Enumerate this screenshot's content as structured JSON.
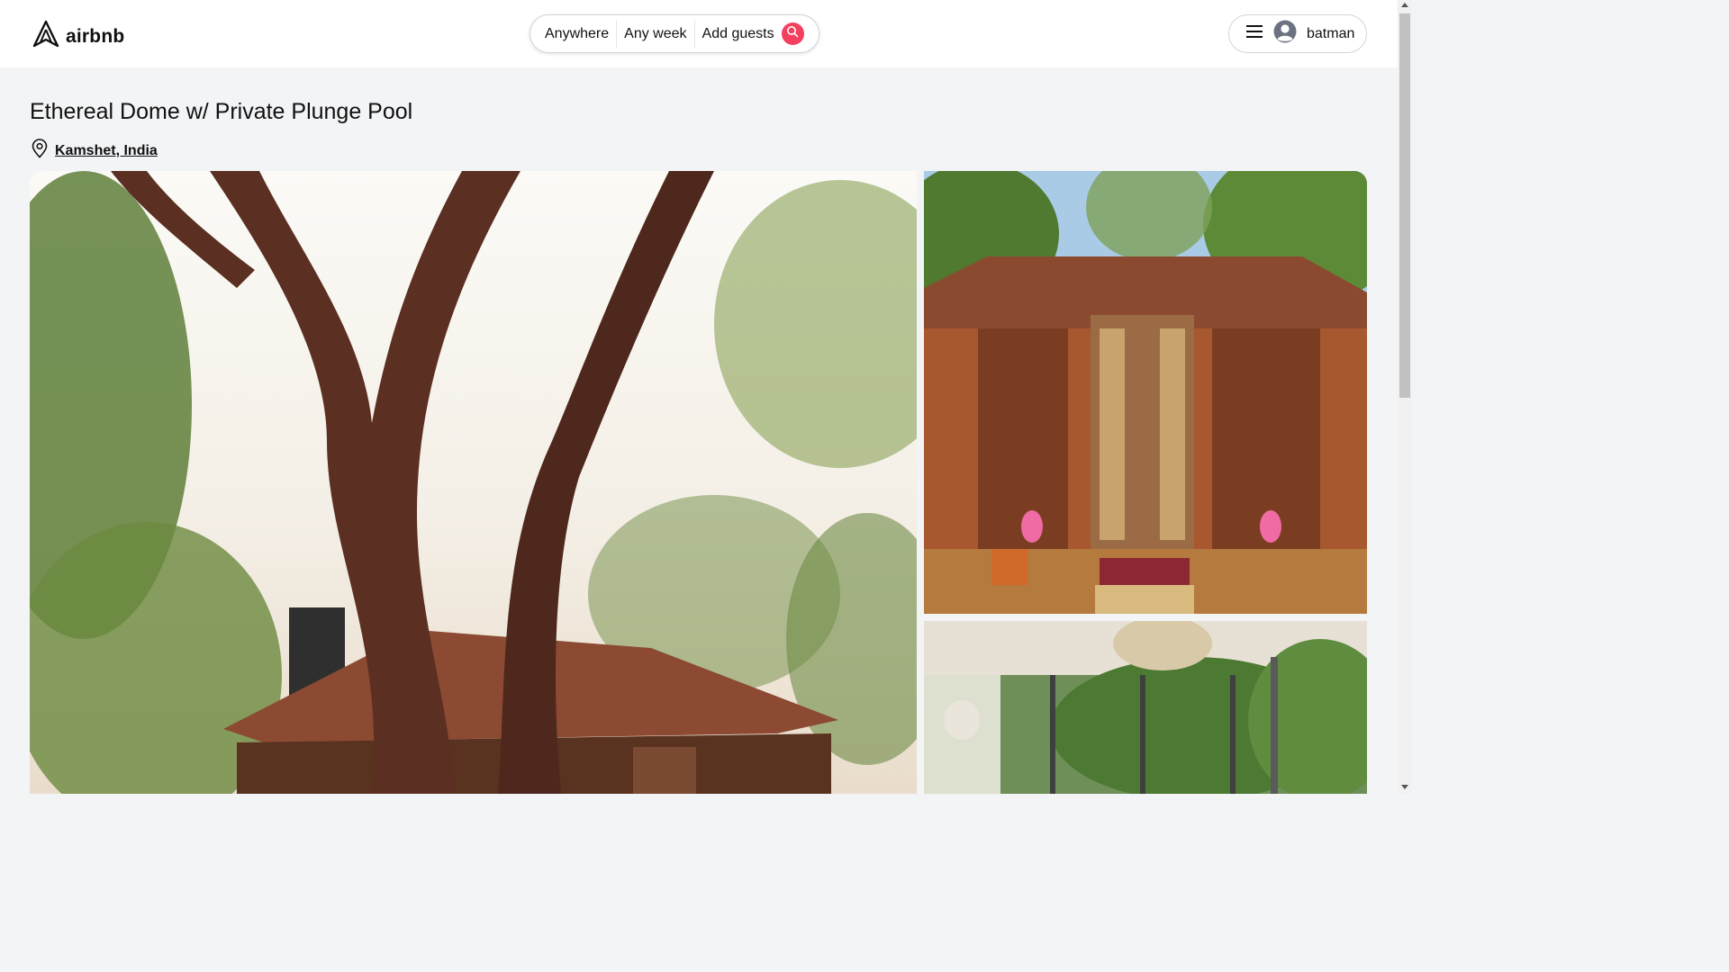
{
  "header": {
    "logo_text": "airbnb",
    "search": {
      "anywhere": "Anywhere",
      "any_week": "Any week",
      "add_guests": "Add guests"
    },
    "user": {
      "name": "batman"
    }
  },
  "listing": {
    "title": "Ethereal Dome w/ Private Plunge Pool",
    "location": "Kamshet, India"
  },
  "colors": {
    "accent": "#f43f5e",
    "page_bg": "#f3f4f6",
    "header_bg": "#ffffff"
  },
  "icons": {
    "logo": "airbnb-logo-icon",
    "search": "search-icon",
    "menu": "menu-icon",
    "avatar": "user-avatar-icon",
    "location": "map-pin-icon"
  }
}
